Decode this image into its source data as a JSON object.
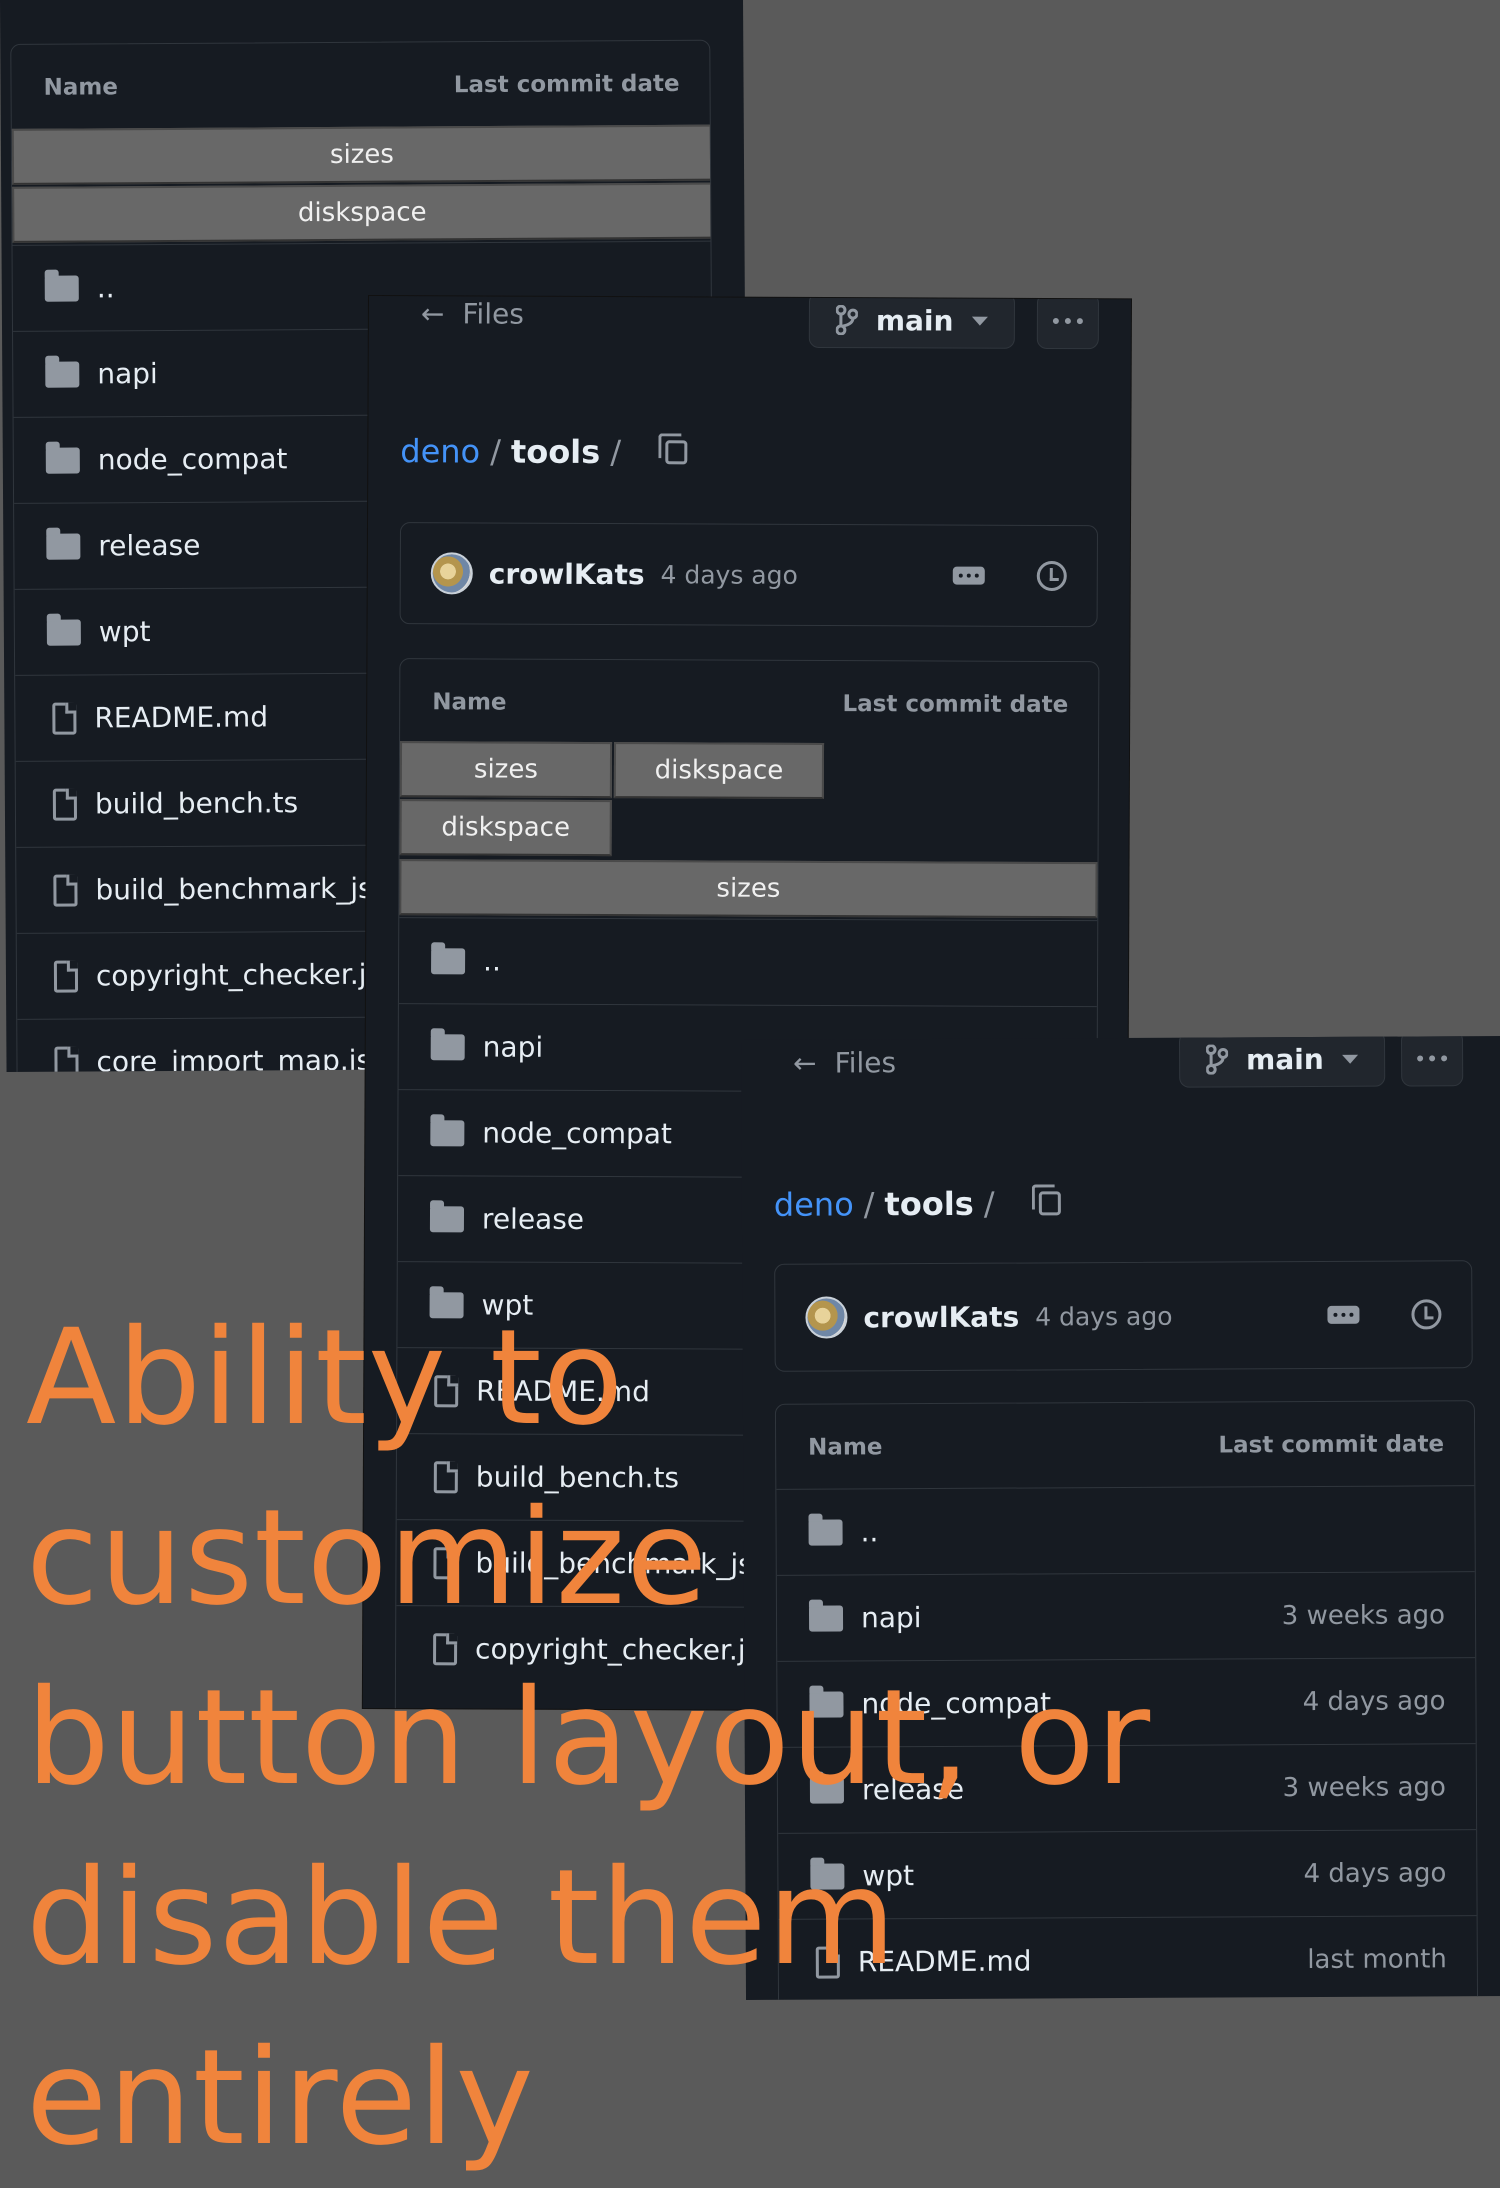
{
  "header": {
    "back_label": "Files",
    "branch": "main"
  },
  "breadcrumb": {
    "repo": "deno",
    "separator": "/",
    "dir": "tools",
    "trailing": "/"
  },
  "commit": {
    "author": "crowlKats",
    "when": "4 days ago"
  },
  "table": {
    "col_name": "Name",
    "col_date": "Last commit date"
  },
  "buttons": {
    "sizes": "sizes",
    "diskspace": "diskspace"
  },
  "rows": [
    {
      "name": "..",
      "kind": "folder",
      "date": ""
    },
    {
      "name": "napi",
      "kind": "folder",
      "date": "3 weeks ago"
    },
    {
      "name": "node_compat",
      "kind": "folder",
      "date": "4 days ago"
    },
    {
      "name": "release",
      "kind": "folder",
      "date": "3 weeks ago"
    },
    {
      "name": "wpt",
      "kind": "folder",
      "date": "4 days ago"
    },
    {
      "name": "README.md",
      "kind": "file",
      "date": "last month"
    },
    {
      "name": "build_bench.ts",
      "kind": "file",
      "date": ""
    },
    {
      "name": "build_benchmark_jsons.js",
      "kind": "file",
      "date": ""
    },
    {
      "name": "copyright_checker.js",
      "kind": "file",
      "date": ""
    },
    {
      "name": "core_import_map.json",
      "kind": "file",
      "date": ""
    }
  ],
  "caption": "Ability to customize button layout, or disable them entirely",
  "colors": {
    "background": "#5a5a5a",
    "panel": "#161b22",
    "link": "#4493f8",
    "caption": "#f0843c",
    "custom_button": "#686868"
  }
}
